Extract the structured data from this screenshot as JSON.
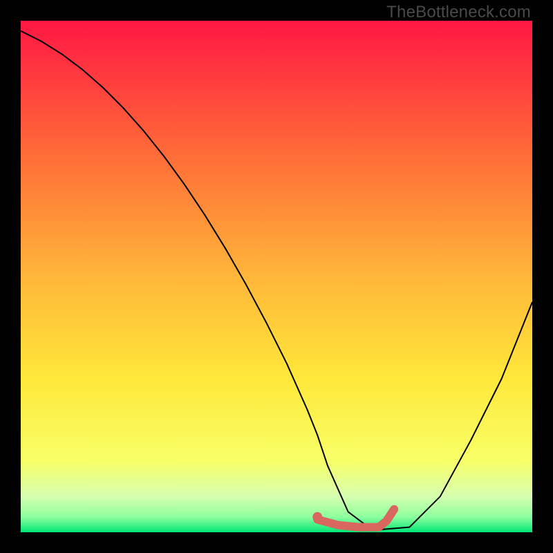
{
  "watermark": "TheBottleneck.com",
  "chart_data": {
    "type": "line",
    "title": "",
    "xlabel": "",
    "ylabel": "",
    "xlim": [
      0,
      100
    ],
    "ylim": [
      0,
      100
    ],
    "gradient_stops": [
      {
        "offset": 0,
        "color": "#ff1744"
      },
      {
        "offset": 25,
        "color": "#ff6838"
      },
      {
        "offset": 50,
        "color": "#ffb63a"
      },
      {
        "offset": 70,
        "color": "#ffe83a"
      },
      {
        "offset": 86,
        "color": "#f8ff68"
      },
      {
        "offset": 93,
        "color": "#d6ffb0"
      },
      {
        "offset": 97,
        "color": "#8eff9e"
      },
      {
        "offset": 100,
        "color": "#00e676"
      }
    ],
    "series": [
      {
        "name": "bottleneck-curve",
        "color": "#000000",
        "stroke_width": 2,
        "x": [
          0,
          4,
          8,
          12,
          16,
          20,
          24,
          28,
          32,
          36,
          40,
          44,
          48,
          52,
          56,
          58,
          60,
          64,
          68,
          70,
          76,
          82,
          88,
          94,
          100
        ],
        "y": [
          98,
          96,
          93.5,
          90.5,
          87,
          83,
          78.5,
          73.5,
          68,
          62,
          55.5,
          48.5,
          41,
          33,
          24,
          19,
          13,
          4,
          1,
          0.5,
          1,
          7,
          18,
          30,
          45
        ]
      },
      {
        "name": "highlight-segment",
        "color": "#d8685f",
        "stroke_width": 12,
        "linecap": "round",
        "x": [
          58,
          62,
          66,
          70,
          71.5,
          73
        ],
        "y": [
          2.5,
          1.4,
          1.0,
          1.0,
          2.2,
          4.5
        ]
      },
      {
        "name": "highlight-dot",
        "type": "scatter",
        "color": "#d8685f",
        "radius": 7,
        "x": [
          58
        ],
        "y": [
          3
        ]
      }
    ]
  }
}
